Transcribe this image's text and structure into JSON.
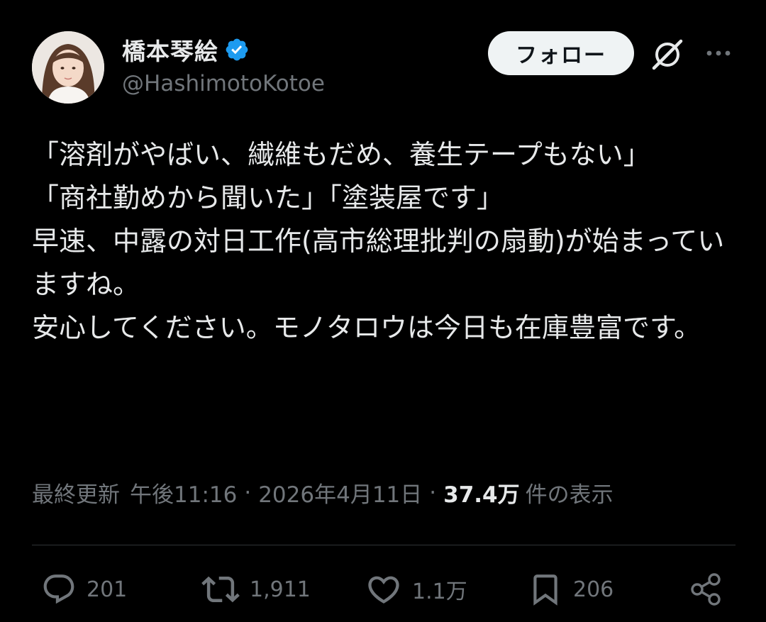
{
  "user": {
    "display_name": "橋本琴絵",
    "handle": "@HashimotoKotoe"
  },
  "follow_label": "フォロー",
  "tweet": {
    "text": "「溶剤がやばい、繊維もだめ、養生テープもない」\n「商社勤めから聞いた」「塗装屋です」\n早速、中露の対日工作(高市総理批判の扇動)が始まっていますね。\n安心してください。モノタロウは今日も在庫豊富です。"
  },
  "meta": {
    "updated_label": "最終更新",
    "time": "午後11:16",
    "separator": "·",
    "date": "2026年4月11日",
    "views_count": "37.4万",
    "views_label": "件の表示"
  },
  "actions": {
    "replies": "201",
    "reposts": "1,911",
    "likes": "1.1万",
    "bookmarks": "206"
  },
  "colors": {
    "background": "#000000",
    "text": "#e7e9ea",
    "muted": "#71767b",
    "verified": "#1d9bf0",
    "divider": "#2f3336"
  }
}
